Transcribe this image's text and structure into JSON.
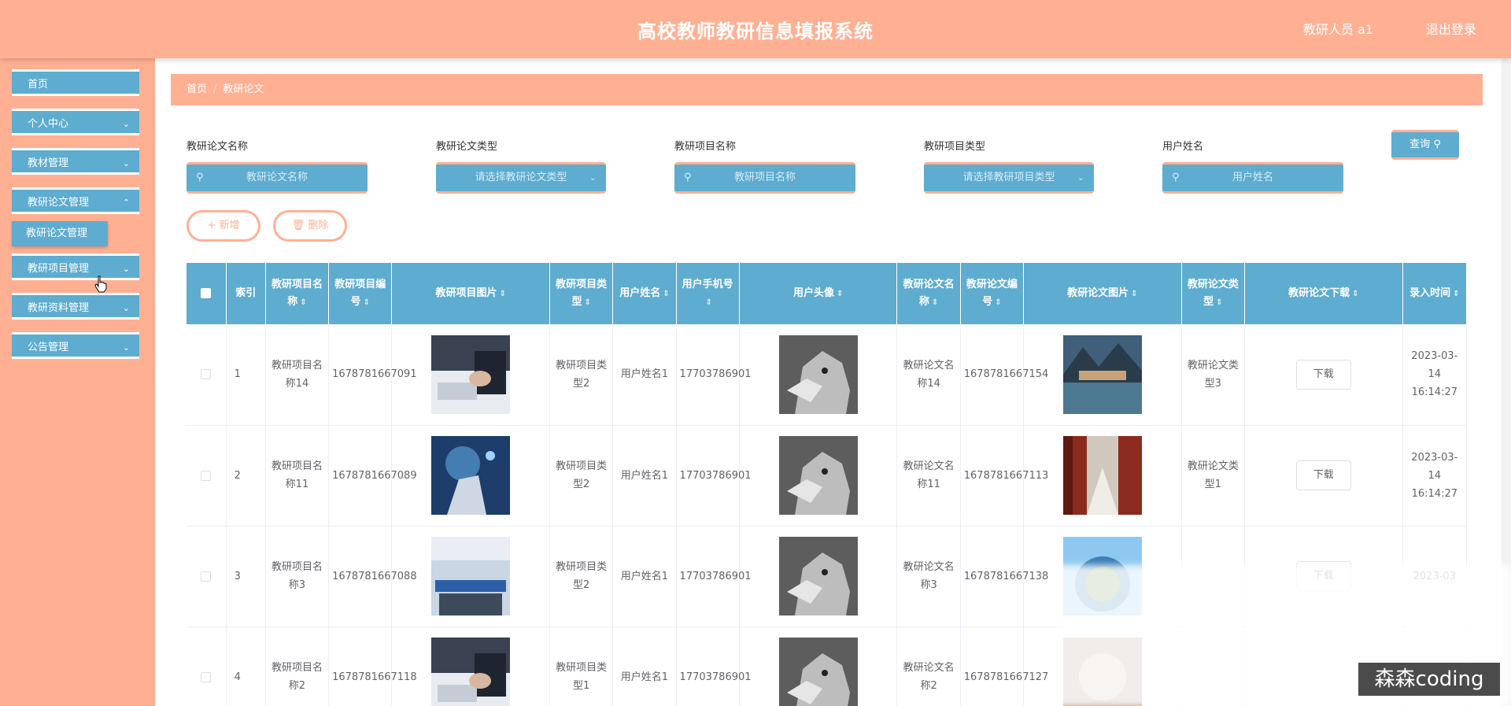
{
  "header": {
    "title": "高校教师教研信息填报系统",
    "user": "教研人员 a1",
    "logout": "退出登录"
  },
  "sidebar": {
    "items": [
      {
        "label": "首页",
        "has_children": false
      },
      {
        "label": "个人中心",
        "has_children": true
      },
      {
        "label": "教材管理",
        "has_children": true
      },
      {
        "label": "教研论文管理",
        "has_children": true
      },
      {
        "label": "教研项目管理",
        "has_children": true
      },
      {
        "label": "教研资料管理",
        "has_children": true
      },
      {
        "label": "公告管理",
        "has_children": true
      }
    ],
    "submenu": "教研论文管理"
  },
  "breadcrumb": {
    "home": "首页",
    "current": "教研论文"
  },
  "filters": [
    {
      "label": "教研论文名称",
      "placeholder": "教研论文名称",
      "type": "input"
    },
    {
      "label": "教研论文类型",
      "placeholder": "请选择教研论文类型",
      "type": "select"
    },
    {
      "label": "教研项目名称",
      "placeholder": "教研项目名称",
      "type": "input"
    },
    {
      "label": "教研项目类型",
      "placeholder": "请选择教研项目类型",
      "type": "select"
    },
    {
      "label": "用户姓名",
      "placeholder": "用户姓名",
      "type": "input"
    }
  ],
  "buttons": {
    "search": "查询",
    "add": "新增",
    "delete": "删除",
    "download": "下载"
  },
  "table": {
    "columns": [
      "索引",
      "教研项目名称",
      "教研项目编号",
      "教研项目图片",
      "教研项目类型",
      "用户姓名",
      "用户手机号",
      "用户头像",
      "教研论文名称",
      "教研论文编号",
      "教研论文图片",
      "教研论文类型",
      "教研论文下载",
      "录入时间"
    ],
    "rows": [
      {
        "index": "1",
        "project_name": "教研项目名称14",
        "project_no": "1678781667091",
        "project_type": "教研项目类型2",
        "user_name": "用户姓名1",
        "phone": "17703786901",
        "paper_name": "教研论文名称14",
        "paper_no": "1678781667154",
        "paper_type": "教研论文类型3",
        "time": "2023-03-14 16:14:27"
      },
      {
        "index": "2",
        "project_name": "教研项目名称11",
        "project_no": "1678781667089",
        "project_type": "教研项目类型2",
        "user_name": "用户姓名1",
        "phone": "17703786901",
        "paper_name": "教研论文名称11",
        "paper_no": "1678781667113",
        "paper_type": "教研论文类型1",
        "time": "2023-03-14 16:14:27"
      },
      {
        "index": "3",
        "project_name": "教研项目名称3",
        "project_no": "1678781667088",
        "project_type": "教研项目类型2",
        "user_name": "用户姓名1",
        "phone": "17703786901",
        "paper_name": "教研论文名称3",
        "paper_no": "1678781667138",
        "paper_type": "",
        "time": "2023-03"
      },
      {
        "index": "4",
        "project_name": "教研项目名称2",
        "project_no": "1678781667118",
        "project_type": "教研项目类型1",
        "user_name": "用户姓名1",
        "phone": "17703786901",
        "paper_name": "教研论文名称2",
        "paper_no": "1678781667127",
        "paper_type": "",
        "time": ""
      }
    ]
  },
  "watermark": "森森coding",
  "colors": {
    "primary": "#ffb093",
    "accent": "#5eaccf"
  }
}
